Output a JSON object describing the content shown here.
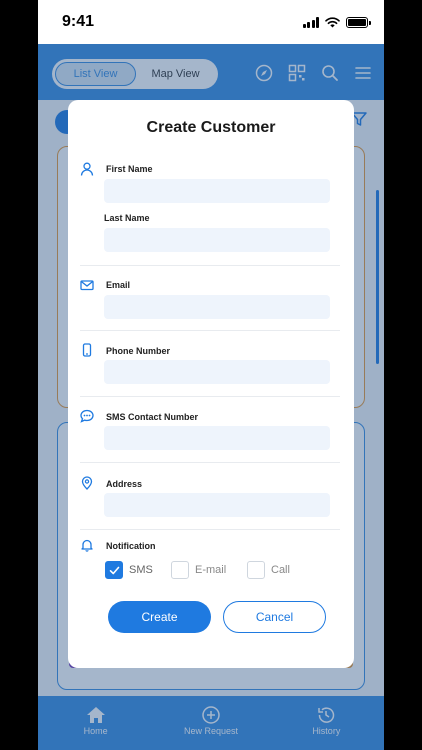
{
  "status_bar": {
    "time": "9:41"
  },
  "header": {
    "tabs": [
      {
        "label": "List View",
        "active": true
      },
      {
        "label": "Map View",
        "active": false
      }
    ],
    "icons": [
      "compass-icon",
      "qr-code-icon",
      "search-icon",
      "menu-icon"
    ]
  },
  "modal": {
    "title": "Create Customer",
    "fields": {
      "first_name": {
        "label": "First Name",
        "value": "",
        "icon": "person-icon"
      },
      "last_name": {
        "label": "Last Name",
        "value": ""
      },
      "email": {
        "label": "Email",
        "value": "",
        "icon": "mail-icon"
      },
      "phone": {
        "label": "Phone Number",
        "value": "",
        "icon": "phone-icon"
      },
      "sms": {
        "label": "SMS Contact Number",
        "value": "",
        "icon": "chat-icon"
      },
      "address": {
        "label": "Address",
        "value": "",
        "icon": "location-pin-icon"
      }
    },
    "notification": {
      "label": "Notification",
      "icon": "bell-icon",
      "options": [
        {
          "label": "SMS",
          "checked": true
        },
        {
          "label": "E-mail",
          "checked": false
        },
        {
          "label": "Call",
          "checked": false
        }
      ]
    },
    "buttons": {
      "create": "Create",
      "cancel": "Cancel"
    }
  },
  "tab_bar": {
    "items": [
      {
        "label": "Home",
        "icon": "home-icon"
      },
      {
        "label": "New Request",
        "icon": "plus-circle-icon"
      },
      {
        "label": "History",
        "icon": "history-icon"
      }
    ]
  },
  "colors": {
    "primary": "#1f7ae0",
    "header": "#3a8de0",
    "input_bg": "#eef4fc"
  }
}
